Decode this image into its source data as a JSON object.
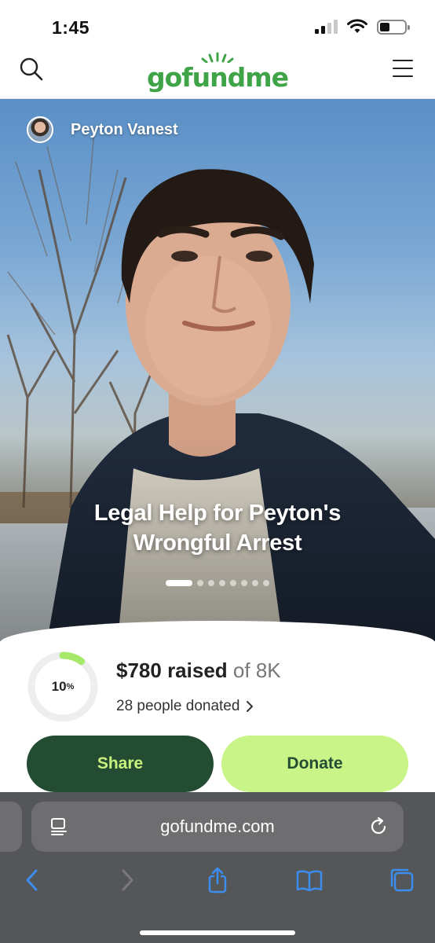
{
  "status_bar": {
    "time": "1:45"
  },
  "header": {
    "logo": "gofundme"
  },
  "campaign": {
    "organizer_name": "Peyton Vanest",
    "title_line1": "Legal Help for Peyton's",
    "title_line2": "Wrongful Arrest",
    "carousel_pages": 8,
    "carousel_active": 1
  },
  "progress": {
    "percent_label": "10",
    "percent_sign": "%",
    "fraction": 0.1,
    "raised_amount": "$780 raised",
    "goal_text": "of 8K",
    "donors_text": "28 people donated"
  },
  "actions": {
    "share_label": "Share",
    "donate_label": "Donate"
  },
  "browser": {
    "url": "gofundme.com"
  },
  "colors": {
    "brand_green": "#3ea447",
    "share_bg": "#244c33",
    "share_text": "#c8f27d",
    "donate_bg": "#c9f488",
    "progress_green": "#a6e86a",
    "safari_blue": "#3b8df0"
  },
  "icons": {
    "search": "search-icon",
    "menu": "hamburger-menu-icon",
    "back": "chevron-left-icon",
    "forward": "chevron-right-icon",
    "share": "share-icon",
    "bookmarks": "book-icon",
    "tabs": "tabs-icon"
  }
}
